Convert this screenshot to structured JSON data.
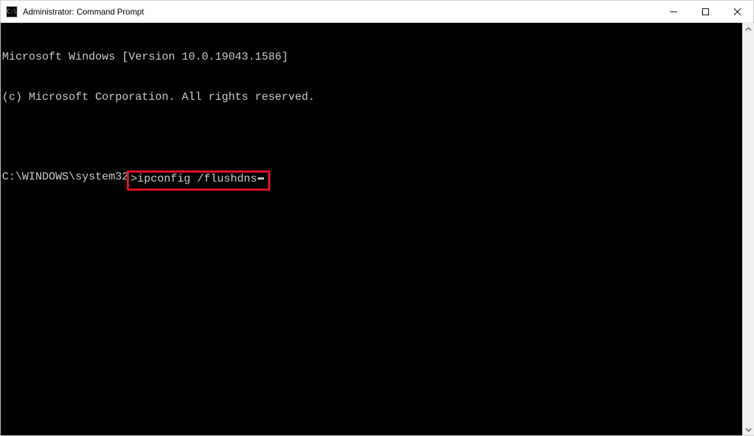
{
  "window": {
    "title": "Administrator: Command Prompt",
    "icon_label": "C:\\"
  },
  "terminal": {
    "header_line1": "Microsoft Windows [Version 10.0.19043.1586]",
    "header_line2": "(c) Microsoft Corporation. All rights reserved.",
    "prompt_path": "C:\\WINDOWS\\system32",
    "prompt_symbol": ">",
    "command": "ipconfig /flushdns"
  },
  "highlight": {
    "color": "#e81123"
  }
}
